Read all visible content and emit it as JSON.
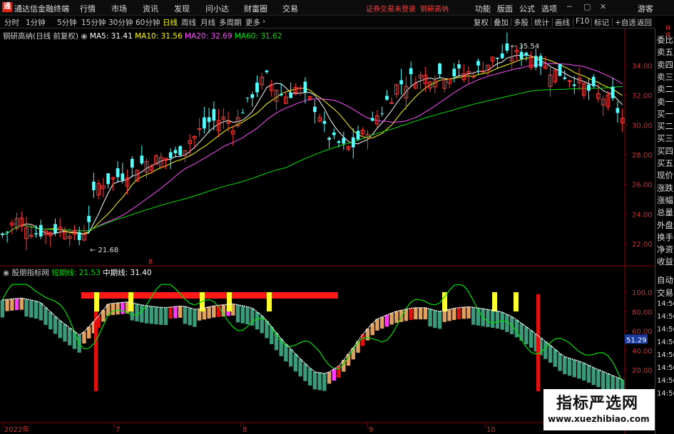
{
  "app": {
    "title": "通达信金融终端",
    "logo": "通"
  },
  "menu": [
    "行情",
    "市场",
    "资讯",
    "发现",
    "问小达",
    "财富圈",
    "交易"
  ],
  "notice": "证券交易未登录",
  "stock_name": "钢研高纳",
  "right_menu": [
    "功能",
    "版面",
    "公式",
    "选项"
  ],
  "guest": "游客",
  "periods": [
    "分时",
    "1分钟",
    "5分钟",
    "15分钟",
    "30分钟",
    "60分钟",
    "日线",
    "周线",
    "月线",
    "多周期",
    "更多"
  ],
  "active_period": "日线",
  "tools": [
    "复权",
    "叠加",
    "多股",
    "统计",
    "画线",
    "F10",
    "标记",
    "+自选",
    "返回"
  ],
  "main_legend": {
    "title": "钢研高纳(日线 前复权)",
    "ma5": "MA5: 31.41",
    "ma10": "MA10: 31.56",
    "ma20": "MA20: 32.69",
    "ma60": "MA60: 31.62"
  },
  "indicator_legend": {
    "name": "股朋指标网",
    "short_label": "短期线: 21.53",
    "mid_label": "中期线: 31.40"
  },
  "price_axis": [
    "34.00",
    "32.00",
    "30.00",
    "28.00",
    "26.00",
    "24.00",
    "22.00"
  ],
  "ind_axis": [
    "100.0",
    "80.00",
    "60.00",
    "40.00",
    "20.00"
  ],
  "ind_current": "51.29",
  "high_label": "35.54",
  "low_label": "21.68",
  "dates": [
    "2022年",
    "7",
    "8",
    "9",
    "10"
  ],
  "date_marker": "8",
  "right_panel_top": [
    "委比",
    "卖五",
    "卖四",
    "卖三",
    "卖二",
    "卖一",
    "买一",
    "买二",
    "买三",
    "买四",
    "买五",
    "现价",
    "涨跌",
    "涨幅",
    "总量",
    "外盘",
    "换手",
    "净资",
    "收益"
  ],
  "right_panel_bottom": [
    "自动",
    "交易",
    "14:56",
    "14:56",
    "14:56",
    "14:56",
    "14:56",
    "14:56",
    "14:56",
    "14:56"
  ],
  "rp_small": "自成",
  "watermark": {
    "line1": "指标严选网",
    "line2": "www.xuezhibiao.com"
  },
  "colors": {
    "up": "#ff3b3b",
    "down": "#54ffff",
    "ma5": "#ffffff",
    "ma10": "#ffff00",
    "ma20": "#ff4fff",
    "ma60": "#00e000",
    "green_bar": "#3a9a7a",
    "tan_bar": "#e0a060"
  }
}
